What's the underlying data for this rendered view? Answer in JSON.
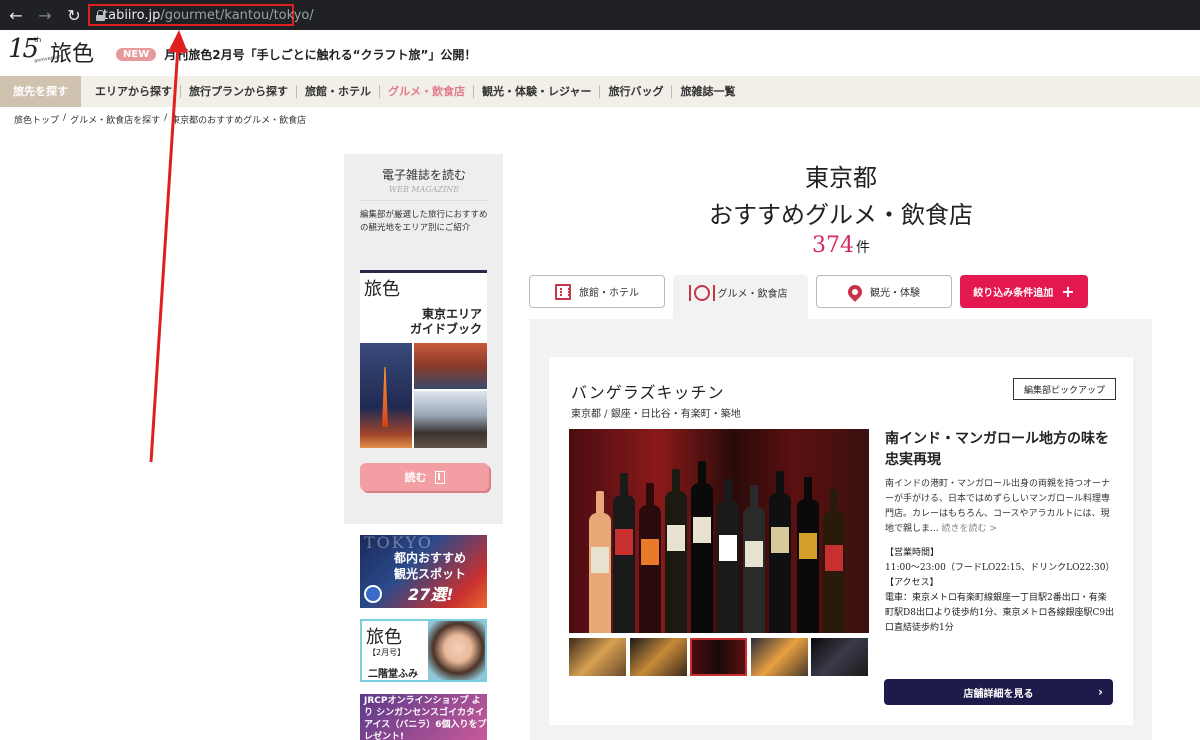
{
  "browser": {
    "url_host": "tabiiro.jp",
    "url_path": "/gourmet/kantou/tokyo/",
    "annotation_color": "#e02020"
  },
  "header": {
    "logo_number": "15",
    "logo_th": "th",
    "logo_anniversary": "anniversary",
    "logo_name": "旅色",
    "news_badge": "NEW",
    "news_text": "月刊旅色2月号「手しごとに触れる“クラフト旅”」公開！"
  },
  "gnav": {
    "search_tag": "旅先を探す",
    "items": [
      {
        "label": "エリアから探す",
        "active": false
      },
      {
        "label": "旅行プランから探す",
        "active": false
      },
      {
        "label": "旅館・ホテル",
        "active": false
      },
      {
        "label": "グルメ・飲食店",
        "active": true
      },
      {
        "label": "観光・体験・レジャー",
        "active": false
      },
      {
        "label": "旅行バッグ",
        "active": false
      },
      {
        "label": "旅雑誌一覧",
        "active": false
      }
    ]
  },
  "breadcrumb": {
    "items": [
      "旅色トップ",
      "/",
      "グルメ・飲食店を探す",
      "/",
      "東京都のおすすめグルメ・飲食店"
    ]
  },
  "sidebar": {
    "title": "電子雑誌を読む",
    "subtitle": "WEB MAGAZINE",
    "description": "編集部が厳選した旅行におすすめの観光地をエリア別にご紹介",
    "mag_brand": "旅色",
    "mag_title_1": "東京エリア",
    "mag_title_2": "ガイドブック",
    "read_label": "読む",
    "banner1_bg": "TOKYO",
    "banner1_line1": "都内おすすめ",
    "banner1_line2": "観光スポット",
    "banner1_line3": "27選!",
    "banner2_brand": "旅色",
    "banner2_month": "【2月号】",
    "banner2_person": "二階堂ふみ",
    "banner3_text": "JRCPオンラインショップ より シンガンセンスゴイカタイアイス（バニラ）6個入りをプレゼント!"
  },
  "main": {
    "title_line1": "東京都",
    "title_line2": "おすすめグルメ・飲食店",
    "count": "374",
    "count_unit": "件",
    "tabs": {
      "hotel": "旅館・ホテル",
      "gourmet": "グルメ・飲食店",
      "sight": "観光・体験"
    },
    "filter_label": "絞り込み条件追加",
    "accent_color": "#e3184f"
  },
  "card": {
    "name": "バンゲラズキッチン",
    "area": "東京都 / 銀座・日比谷・有楽町・築地",
    "pick_label": "編集部ピックアップ",
    "lead": "南インド・マンガロール地方の味を忠実再現",
    "body": "南インドの港町・マンガロール出身の両親を持つオーナーが手がける、日本ではめずらしいマンガロール料理専門店。カレーはもちろん、コースやアラカルトには、現地で親しま...",
    "more_label": "続きを読む >",
    "hours_heading": "【営業時間】",
    "hours": "11:00～23:00（フードLO22:15、ドリンクLO22:30）",
    "access_heading": "【アクセス】",
    "access": "電車：東京メトロ有楽町線銀座一丁目駅2番出口・有楽町駅D8出口より徒歩約1分、東京メトロ各線銀座駅C9出口直結徒歩約1分",
    "detail_label": "店舗詳細を見る",
    "detail_color": "#1e1a4a"
  }
}
